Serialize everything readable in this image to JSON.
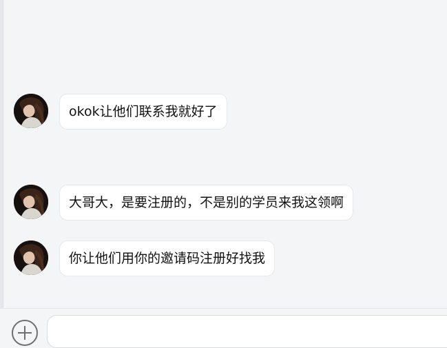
{
  "chat": {
    "messages": [
      {
        "sender": "avatar",
        "text": "okok让他们联系我就好了"
      },
      {
        "sender": "avatar",
        "text": "大哥大，是要注册的，不是别的学员来我这领啊"
      },
      {
        "sender": "avatar",
        "text": "你让他们用你的邀请码注册好找我"
      }
    ]
  },
  "composer": {
    "input_value": "",
    "input_placeholder": ""
  },
  "icons": {
    "add": "plus-circle-icon",
    "avatar": "avatar-portrait"
  }
}
